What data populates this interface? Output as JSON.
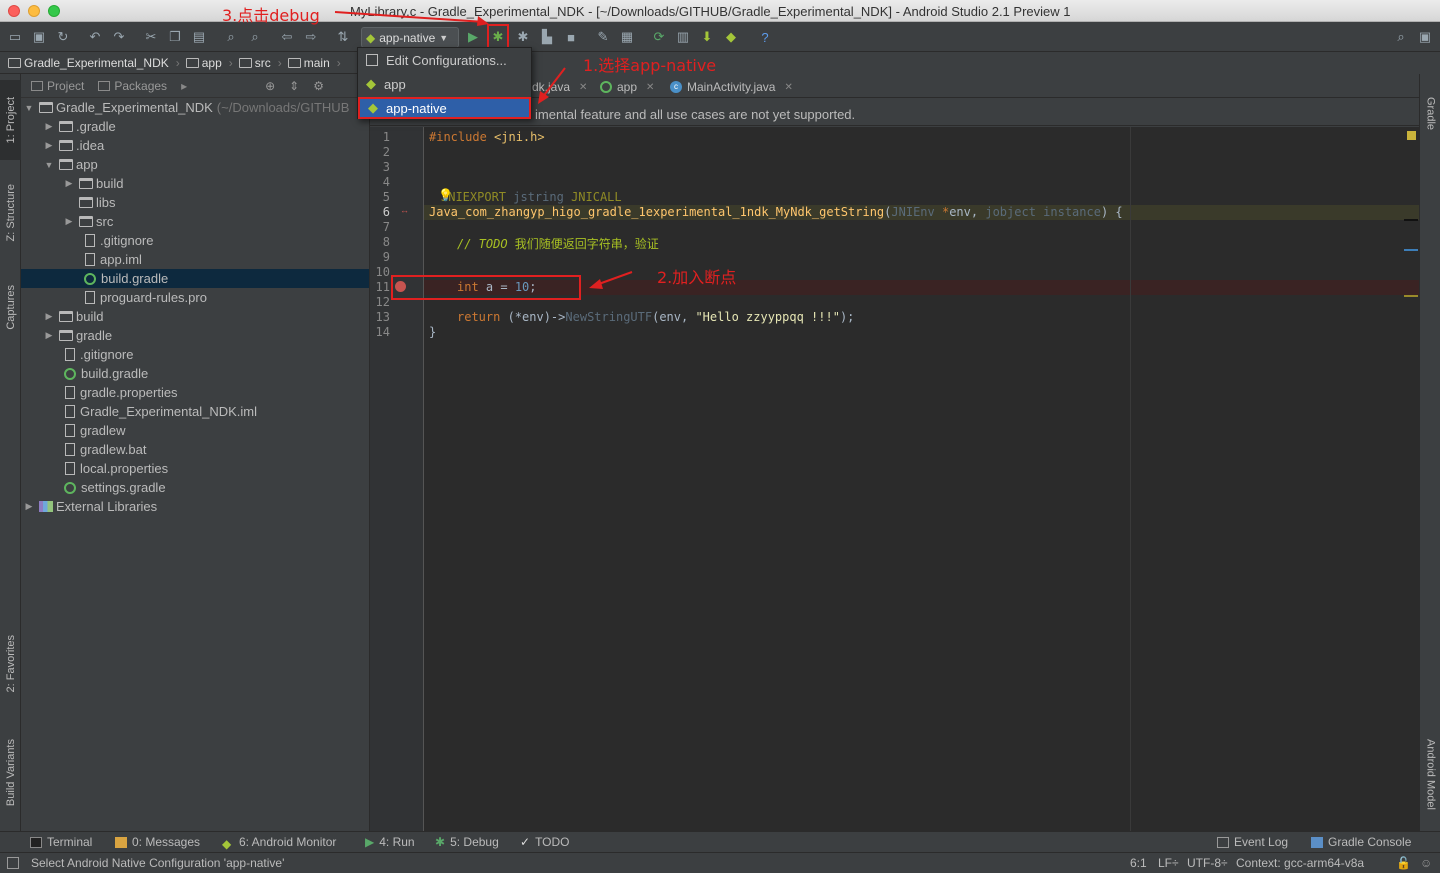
{
  "window": {
    "title": "MyLibrary.c - Gradle_Experimental_NDK - [~/Downloads/GITHUB/Gradle_Experimental_NDK] - Android Studio 2.1 Preview 1"
  },
  "toolbar": {
    "run_config": "app-native"
  },
  "navbar": {
    "crumbs": [
      "Gradle_Experimental_NDK",
      "app",
      "src",
      "main"
    ]
  },
  "left_tabs": {
    "project": "1: Project",
    "structure": "Z: Structure",
    "captures": "Captures",
    "favorites": "2: Favorites",
    "build_variants": "Build Variants"
  },
  "right_tabs": {
    "gradle": "Gradle",
    "android_model": "Android Model"
  },
  "project_panel": {
    "tab_project": "Project",
    "tab_packages": "Packages",
    "root": "Gradle_Experimental_NDK",
    "root_path": "(~/Downloads/GITHUB",
    "items": [
      ".gradle",
      ".idea",
      "app",
      "build",
      "libs",
      "src",
      ".gitignore",
      "app.iml",
      "build.gradle",
      "proguard-rules.pro",
      "build",
      "gradle",
      ".gitignore",
      "build.gradle",
      "gradle.properties",
      "Gradle_Experimental_NDK.iml",
      "gradlew",
      "gradlew.bat",
      "local.properties",
      "settings.gradle",
      "External Libraries"
    ]
  },
  "editor": {
    "tabs": [
      "dk.java",
      "app",
      "MainActivity.java"
    ],
    "notice": "imental feature and all use cases are not yet supported.",
    "line_numbers": [
      "1",
      "2",
      "3",
      "4",
      "5",
      "6",
      "7",
      "8",
      "9",
      "10",
      "11",
      "12",
      "13",
      "14"
    ],
    "code": {
      "l1_a": "#include ",
      "l1_b": "<jni.h>",
      "l5_a": "JNIEXPORT",
      "l5_b": " jstring ",
      "l5_c": "JNICALL",
      "l6_fn": "Java_com_zhangyp_higo_gradle_1experimental_1ndk_MyNdk_getString",
      "l6_p1": "(",
      "l6_t1": "JNIEnv",
      "l6_star": " *",
      "l6_env": "env",
      "l6_comma": ", ",
      "l6_t2": "jobject",
      "l6_inst": " instance",
      "l6_end": ") {",
      "l8_todo": "// TODO ",
      "l8_cn": "我们随便返回字符串，验证",
      "l11_kw": "int",
      "l11_rest": " a = ",
      "l11_num": "10",
      "l11_end": ";",
      "l13_kw": "return",
      "l13_a": " (*env)->",
      "l13_fn": "NewStringUTF",
      "l13_b": "(env, ",
      "l13_str": "\"Hello zzyyppqq !!!\"",
      "l13_end": ");",
      "l14": "}"
    }
  },
  "dropdown": {
    "items": [
      "Edit Configurations...",
      "app",
      "app-native"
    ]
  },
  "annotations": {
    "step1": "1.选择app-native",
    "step2": "2.加入断点",
    "step3": "3.点击debug"
  },
  "bottom_tabs": {
    "terminal": "Terminal",
    "messages": "0: Messages",
    "monitor": "6: Android Monitor",
    "run": "4: Run",
    "debug": "5: Debug",
    "todo": "TODO",
    "event_log": "Event Log",
    "gradle_console": "Gradle Console"
  },
  "status": {
    "message": "Select Android Native Configuration 'app-native'",
    "position": "6:1",
    "line_sep": "LF÷",
    "encoding": "UTF-8÷",
    "context": "Context: gcc-arm64-v8a"
  }
}
